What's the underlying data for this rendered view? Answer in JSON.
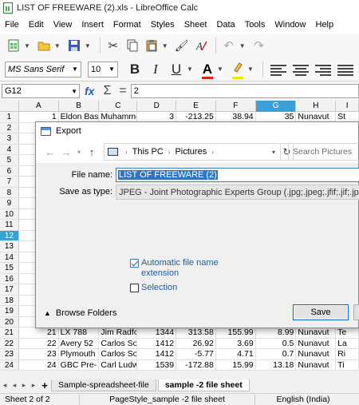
{
  "window": {
    "title": "LIST OF FREEWARE (2).xls - LibreOffice Calc"
  },
  "menu": [
    "File",
    "Edit",
    "View",
    "Insert",
    "Format",
    "Styles",
    "Sheet",
    "Data",
    "Tools",
    "Window",
    "Help"
  ],
  "format_toolbar": {
    "font_name": "MS Sans Serif",
    "font_size": "10",
    "bold": "B",
    "italic": "I",
    "underline": "U",
    "font_color": "A",
    "font_color_hex": "#d9251d",
    "highlight_hex": "#f2e600"
  },
  "formula_bar": {
    "cell_ref": "G12",
    "fx": "fx",
    "sum": "Σ",
    "equals": "=",
    "content": "2"
  },
  "columns": [
    "A",
    "B",
    "C",
    "D",
    "E",
    "F",
    "G",
    "H",
    "I"
  ],
  "selected_column": "G",
  "selected_row": "12",
  "rows": [
    {
      "num": "1",
      "A": "1",
      "B": "Eldon Bas",
      "C": "Muhamme",
      "D": "3",
      "E": "-213.25",
      "F": "38.94",
      "G": "35",
      "H": "Nunavut",
      "I": "St"
    },
    {
      "num": "2"
    },
    {
      "num": "3"
    },
    {
      "num": "4"
    },
    {
      "num": "5"
    },
    {
      "num": "6"
    },
    {
      "num": "7"
    },
    {
      "num": "8"
    },
    {
      "num": "9"
    },
    {
      "num": "10"
    },
    {
      "num": "11"
    },
    {
      "num": "12"
    },
    {
      "num": "13"
    },
    {
      "num": "14"
    },
    {
      "num": "15"
    },
    {
      "num": "16"
    },
    {
      "num": "17"
    },
    {
      "num": "18"
    },
    {
      "num": "19"
    },
    {
      "num": "20"
    },
    {
      "num": "21",
      "A": "21",
      "B": "LX 788",
      "C": "Jim Radfo",
      "D": "1344",
      "E": "313.58",
      "F": "155.99",
      "G": "8.99",
      "H": "Nunavut",
      "I": "Te"
    },
    {
      "num": "22",
      "A": "22",
      "B": "Avery 52",
      "C": "Carlos So",
      "D": "1412",
      "E": "26.92",
      "F": "3.69",
      "G": "0.5",
      "H": "Nunavut",
      "I": "La"
    },
    {
      "num": "23",
      "A": "23",
      "B": "Plymouth",
      "C": "Carlos So",
      "D": "1412",
      "E": "-5.77",
      "F": "4.71",
      "G": "0.7",
      "H": "Nunavut",
      "I": "Ri"
    },
    {
      "num": "24",
      "A": "24",
      "B": "GBC Pre-",
      "C": "Carl Ludw",
      "D": "1539",
      "E": "-172.88",
      "F": "15.99",
      "G": "13.18",
      "H": "Nunavut",
      "I": "Ti"
    }
  ],
  "dialog": {
    "title": "Export",
    "breadcrumb": [
      "This PC",
      "Pictures"
    ],
    "search_placeholder": "Search Pictures",
    "file_name_label": "File name:",
    "file_name_value": "LIST OF FREEWARE (2)",
    "save_as_type_label": "Save as type:",
    "save_as_type_value": "JPEG - Joint Photographic Experts Group (.jpg;.jpeg;.jfif;.jif;.jpe)",
    "auto_ext_label": "Automatic file name extension",
    "auto_ext_checked": true,
    "selection_label": "Selection",
    "selection_checked": false,
    "browse_folders": "Browse Folders",
    "save_button": "Save"
  },
  "sheet_tabs": [
    "Sample-spreadsheet-file",
    "sample -2 file sheet"
  ],
  "active_tab": "sample -2 file sheet",
  "status": {
    "sheet": "Sheet 2 of 2",
    "page_style": "PageStyle_sample -2 file sheet",
    "language": "English (India)"
  }
}
